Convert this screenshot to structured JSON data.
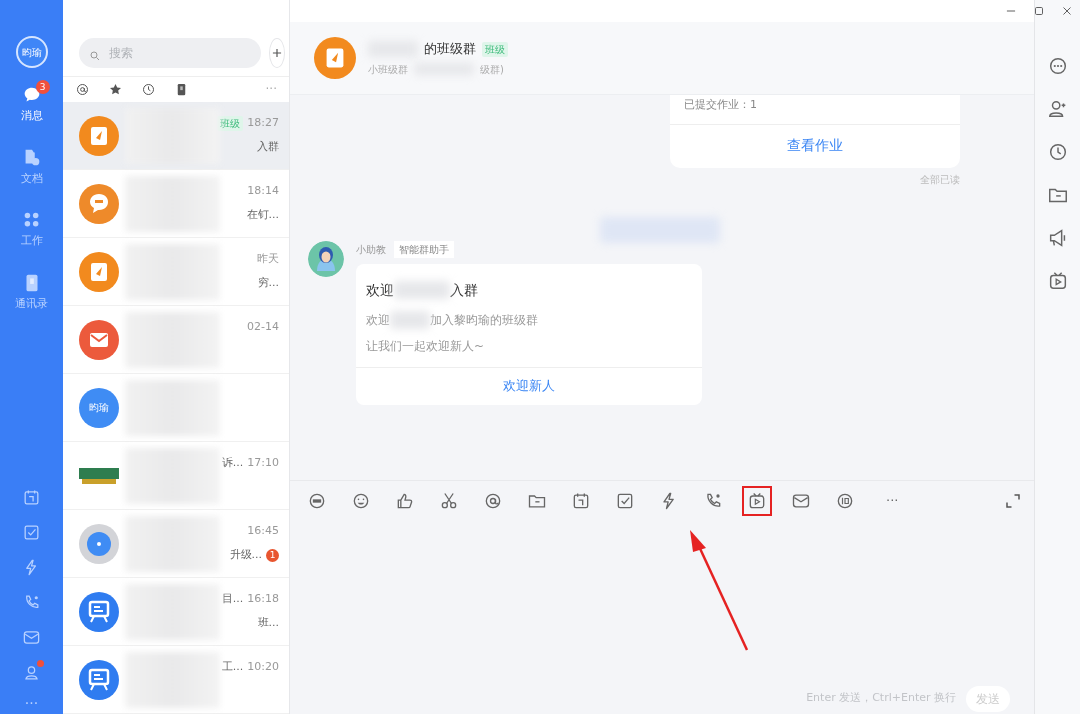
{
  "nav": {
    "avatar": "昀瑜",
    "items": [
      {
        "label": "消息",
        "badge": "3",
        "selected": true
      },
      {
        "label": "文档",
        "selected": false
      },
      {
        "label": "工作",
        "selected": false
      },
      {
        "label": "通讯录",
        "selected": false
      }
    ],
    "alert_dot": true,
    "more": "···"
  },
  "search": {
    "placeholder": "搜索"
  },
  "filters": {
    "more": "···"
  },
  "conversations": [
    {
      "kind": "book",
      "color": "#f28a1e",
      "tag": "班级",
      "time": "18:27",
      "snippet": "入群",
      "selected": true
    },
    {
      "kind": "bubble",
      "color": "#ee8a2a",
      "time": "18:14",
      "snippet": "在钉...",
      "selected": false
    },
    {
      "kind": "book",
      "color": "#f28a1e",
      "time": "昨天",
      "snippet": "穷...",
      "selected": false
    },
    {
      "kind": "mail",
      "color": "#ec5a3c",
      "time": "02-14",
      "selected": false
    },
    {
      "kind": "text",
      "avatar_text": "昀瑜",
      "color": "#3f8cf4",
      "selected": false
    },
    {
      "kind": "logo",
      "color": "#2e7d4f",
      "title_tail": "诉...",
      "time": "17:10",
      "selected": false
    },
    {
      "kind": "ring",
      "color": "#3f8cf4",
      "time": "16:45",
      "snippet": "升级...",
      "unread": "1",
      "selected": false
    },
    {
      "kind": "easel",
      "color": "#2f7cf0",
      "title_tail": "目...",
      "time": "16:18",
      "snippet": "班...",
      "selected": false
    },
    {
      "kind": "easel",
      "color": "#2f7cf0",
      "title_tail": "工...",
      "time": "10:20",
      "selected": false
    }
  ],
  "chat": {
    "title": "的班级群",
    "tag": "班级",
    "subtitle": "小班级群",
    "subtitle_tail": "级群)",
    "homework": {
      "line": "已提交作业：1",
      "button": "查看作业",
      "read_status": "全部已读"
    },
    "message": {
      "sender": "小助教",
      "sender_tag": "智能群助手",
      "title_start": "欢迎",
      "title_end": "入群",
      "body_start": "欢迎",
      "body_end": "加入黎昀瑜的班级群",
      "body_line": "让我们一起欢迎新人~",
      "button": "欢迎新人"
    },
    "toolbar": [
      {
        "highlighted": false
      },
      {
        "highlighted": false
      },
      {
        "highlighted": false
      },
      {
        "highlighted": false
      },
      {
        "highlighted": false
      },
      {
        "highlighted": false
      },
      {
        "highlighted": false
      },
      {
        "highlighted": false
      },
      {
        "highlighted": false
      },
      {
        "highlighted": false
      },
      {
        "highlighted": true
      },
      {
        "highlighted": false
      },
      {
        "highlighted": false
      }
    ],
    "toolbar_more": "···",
    "hint": "Enter 发送，Ctrl+Enter 换行",
    "send": "发送"
  }
}
